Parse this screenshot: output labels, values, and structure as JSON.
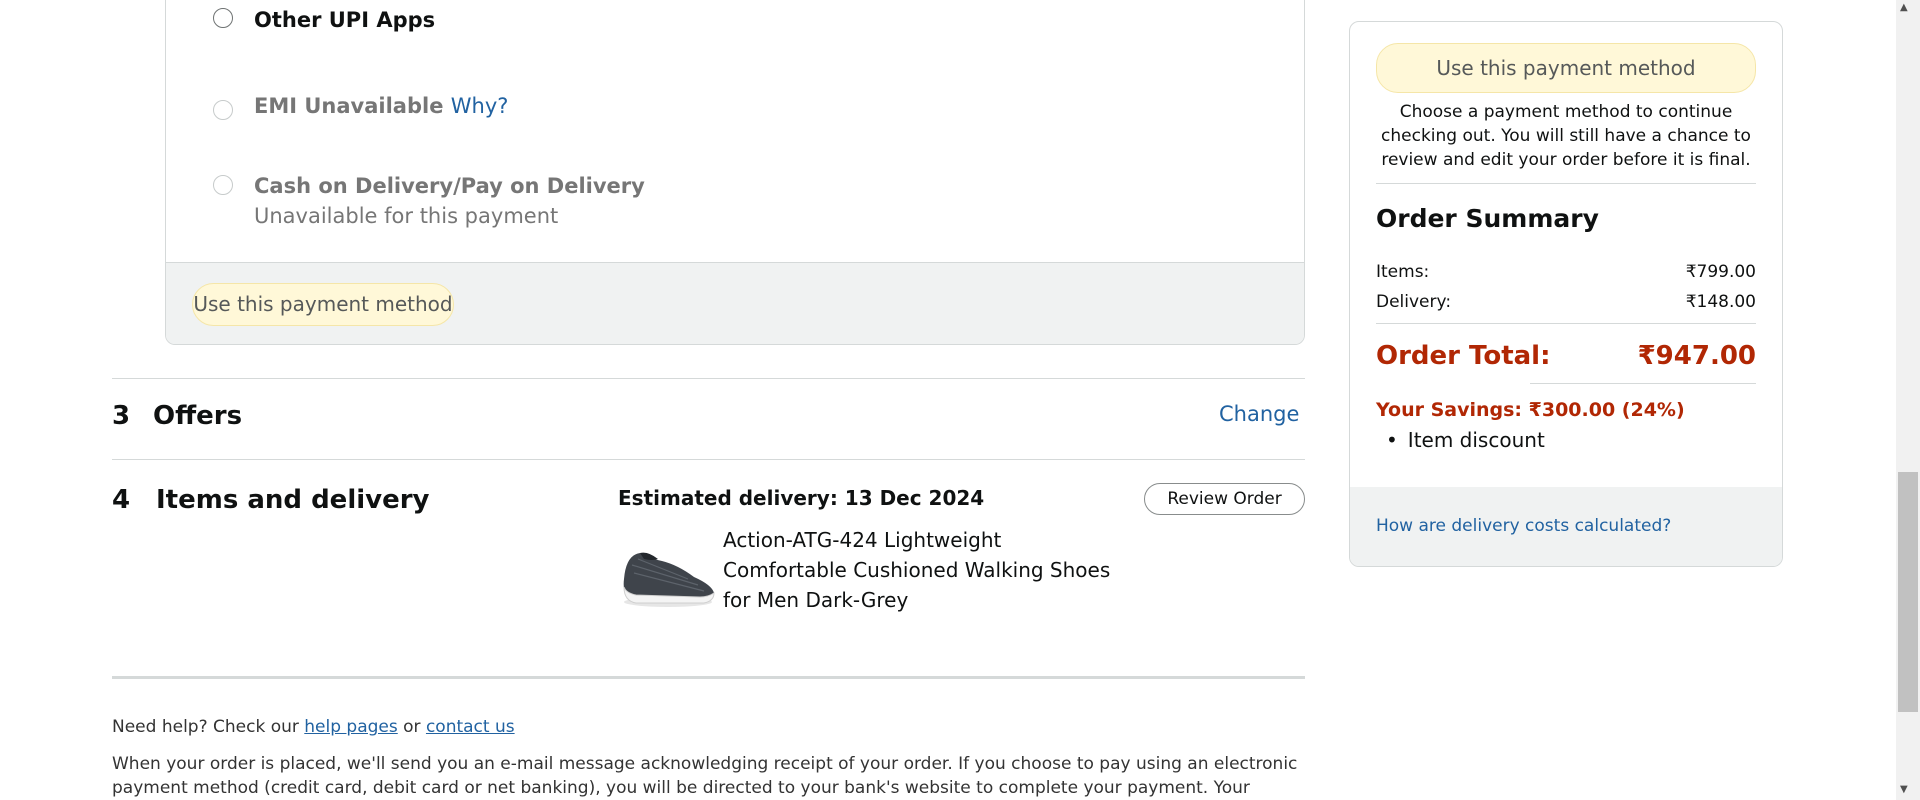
{
  "payment": {
    "other_upi": "Other UPI Apps",
    "emi_label": "EMI Unavailable",
    "emi_why": "Why?",
    "cod_label": "Cash on Delivery/Pay on Delivery",
    "cod_sub": "Unavailable for this payment",
    "use_button": "Use this payment method"
  },
  "sections": {
    "offers_num": "3",
    "offers_title": "Offers",
    "offers_change": "Change",
    "items_num": "4",
    "items_title": "Items and delivery",
    "estimated_delivery": "Estimated delivery: 13 Dec 2024",
    "review_button": "Review Order",
    "product_name": "Action-ATG-424 Lightweight Comfortable Cushioned Walking Shoes for Men Dark-Grey"
  },
  "summary": {
    "use_button": "Use this payment method",
    "note": "Choose a payment method to continue checking out. You will still have a chance to review and edit your order before it is final.",
    "title": "Order Summary",
    "items_label": "Items:",
    "items_value": "₹799.00",
    "delivery_label": "Delivery:",
    "delivery_value": "₹148.00",
    "total_label": "Order Total:",
    "total_value": "₹947.00",
    "savings": "Your Savings: ₹300.00 (24%)",
    "savings_item": "Item discount",
    "delivery_costs_link": "How are delivery costs calculated?"
  },
  "footer": {
    "help_prefix": "Need help? Check our",
    "help_pages": "help pages",
    "or": "or",
    "contact_us": "contact us",
    "notice": "When your order is placed, we'll send you an e-mail message acknowledging receipt of your order. If you choose to pay using an electronic payment method (credit card, debit card or net banking), you will be directed to your bank's website to complete your payment. Your contract to"
  },
  "colors": {
    "link": "#2162a1",
    "total_red": "#b12704",
    "button_yellow": "#fff8d8",
    "panel_grey": "#f0f2f2"
  }
}
